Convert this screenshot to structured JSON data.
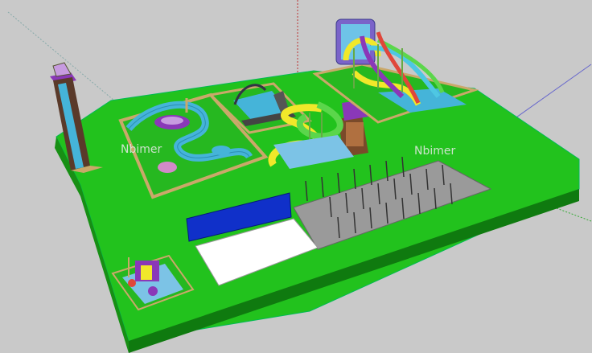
{
  "scene": {
    "watermarks": [
      "Nbimer",
      "Nbimer"
    ],
    "colors": {
      "background": "#c9c9c9",
      "grass_top": "#22c21d",
      "grass_side": "#178f14",
      "grass_front": "#0f7a0f",
      "water": "#45b4d9",
      "pool_tile": "#7cc3e6",
      "path": "#caa86a",
      "slide_yellow": "#f1e82a",
      "slide_green": "#5bd64b",
      "slide_blue": "#4ec7e3",
      "slide_purple": "#8a38b8",
      "blue_block": "#1030c9",
      "parking": "#9a9a9a",
      "white_area": "#ffffff"
    }
  }
}
